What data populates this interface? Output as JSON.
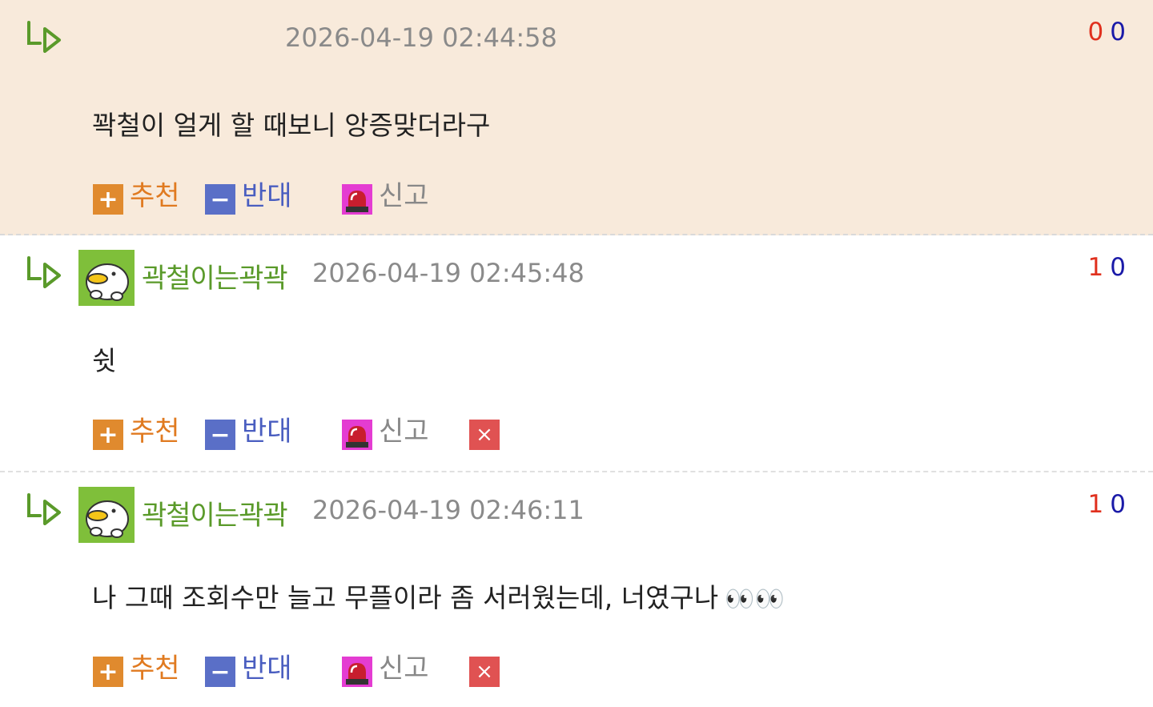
{
  "colors": {
    "highlight_bg": "#f8eadb",
    "nickname": "#5a9a2a",
    "recommend": "#e07a20",
    "oppose": "#4a5ec0",
    "vote_up": "#e0301e",
    "vote_down": "#1a1aa8",
    "report_icon": "#e43cd2",
    "delete_icon": "#e05252"
  },
  "comments": [
    {
      "nickname": "",
      "datetime": "2026-04-19 02:44:58",
      "up_votes": "0",
      "down_votes": "0",
      "text": "꽉철이 얼게 할 때보니 앙증맞더라구",
      "emoji": "",
      "actions": {
        "recommend": "추천",
        "oppose": "반대",
        "report": "신고"
      },
      "icons": [
        "reply-arrow-icon",
        "plus-icon",
        "minus-icon",
        "siren-icon"
      ]
    },
    {
      "nickname": "곽철이는곽곽",
      "datetime": "2026-04-19 02:45:48",
      "up_votes": "1",
      "down_votes": "0",
      "text": "쉿",
      "emoji": "",
      "actions": {
        "recommend": "추천",
        "oppose": "반대",
        "report": "신고",
        "delete": "×"
      },
      "icons": [
        "reply-arrow-icon",
        "duck-avatar",
        "plus-icon",
        "minus-icon",
        "siren-icon",
        "close-icon"
      ]
    },
    {
      "nickname": "곽철이는곽곽",
      "datetime": "2026-04-19 02:46:11",
      "up_votes": "1",
      "down_votes": "0",
      "text": "나 그때 조회수만 늘고 무플이라 좀 서러웠는데, 너였구나",
      "emoji": "👀",
      "actions": {
        "recommend": "추천",
        "oppose": "반대",
        "report": "신고",
        "delete": "×"
      },
      "icons": [
        "reply-arrow-icon",
        "duck-avatar",
        "plus-icon",
        "minus-icon",
        "siren-icon",
        "close-icon"
      ]
    }
  ]
}
